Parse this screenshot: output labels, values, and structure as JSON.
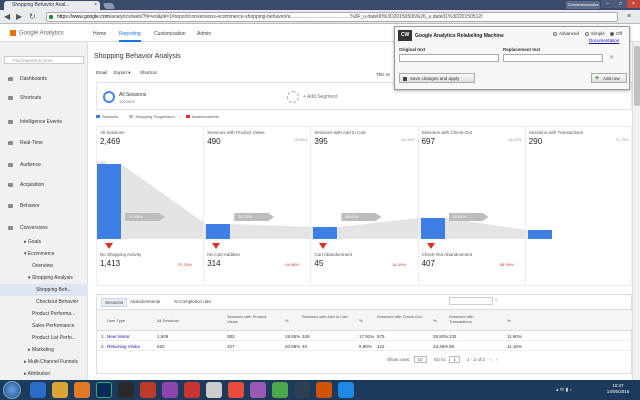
{
  "browser": {
    "tab_title": "Shopping Behavior Anal...",
    "url_host": "https://www.google.com",
    "url_path": "/analytics/web/?hl=en&pli=1#report/conversions-ecommerce-shopping-behavior/a...........................................%3F_u.date00%3D20150506%26_u.date01%3D20150512/",
    "user_button": "Conversionworks"
  },
  "ga": {
    "logo_text": "Google Analytics",
    "tabs": [
      "Home",
      "Reporting",
      "Customization",
      "Admin"
    ],
    "active_tab": "Reporting"
  },
  "sidebar": {
    "search_placeholder": "Find reports & more",
    "items": [
      {
        "label": "Dashboards"
      },
      {
        "label": "Shortcuts"
      },
      {
        "label": "Intelligence Events"
      },
      {
        "label": "Real-Time"
      },
      {
        "label": "Audience"
      },
      {
        "label": "Acquisition"
      },
      {
        "label": "Behavior"
      },
      {
        "label": "Conversions"
      },
      {
        "label": "▸ Goals"
      },
      {
        "label": "▾ Ecommerce"
      },
      {
        "label": "Overview"
      },
      {
        "label": "▾ Shopping Analysis"
      },
      {
        "label": "Shopping Beh..."
      },
      {
        "label": "Checkout Behavior"
      },
      {
        "label": "Product Performa..."
      },
      {
        "label": "Sales Performance"
      },
      {
        "label": "Product List Perfo..."
      },
      {
        "label": "▸ Marketing"
      },
      {
        "label": "▸ Multi-Channel Funnels"
      },
      {
        "label": "▸ Attribution"
      }
    ]
  },
  "report": {
    "title": "Shopping Behavior Analysis",
    "toolbar": [
      "Email",
      "Export ▾",
      "Shortcut"
    ],
    "date_fragment": "This re",
    "segment1_label": "All Sessions",
    "segment1_pct": "100.00%",
    "segment2_label": "+ Add Segment",
    "legend": [
      "Sessions",
      "Shopping Progression",
      "Abandonments"
    ]
  },
  "colors": {
    "bar": "#3e7fe6",
    "progression": "#bdbdbd",
    "abandon": "#d93025",
    "accent": "#1a73e8"
  },
  "chart_data": {
    "type": "bar",
    "stages": [
      {
        "label": "All Sessions",
        "value": "2,469",
        "pct": "",
        "bar_value": 2469
      },
      {
        "label": "Sessions with Product Views",
        "value": "490",
        "pct": "19.85%",
        "bar_value": 490
      },
      {
        "label": "Sessions with Add to Cart",
        "value": "395",
        "pct": "16.00%",
        "bar_value": 395
      },
      {
        "label": "Sessions with Check-Out",
        "value": "697",
        "pct": "28.23%",
        "bar_value": 697
      },
      {
        "label": "Sessions with Transactions",
        "value": "290",
        "pct": "11.75%",
        "bar_value": 290
      }
    ],
    "progression_rates": [
      "19.85%",
      "31.22%",
      "88.61%",
      "41.61%"
    ],
    "abandonments": [
      {
        "label": "No Shopping Activity",
        "value": "1,413",
        "pct": "57.23%"
      },
      {
        "label": "No Cart Addition",
        "value": "314",
        "pct": "64.08%"
      },
      {
        "label": "Cart Abandonment",
        "value": "45",
        "pct": "11.39%"
      },
      {
        "label": "Check-Out Abandonment",
        "value": "407",
        "pct": "58.39%"
      }
    ],
    "yticks": [
      "2,500",
      "2,000",
      "1,500",
      "1,000",
      "500",
      "0"
    ],
    "ylim": [
      0,
      2500
    ]
  },
  "table": {
    "tabs": [
      "Sessions",
      "Abandonments",
      "% Completion rate"
    ],
    "search_placeholder": "",
    "headers": [
      "User Type",
      "All Sessions",
      "Sessions with Product Views",
      "%",
      "Sessions with Add to Cart",
      "%",
      "Sessions with Check-Out",
      "%",
      "Sessions with Transactions",
      "%"
    ],
    "rows": [
      [
        "1.",
        "New Visitor",
        "1,949",
        "383",
        "19.65%",
        "349",
        "17.91%",
        "575",
        "29.50%",
        "232",
        "11.90%"
      ],
      [
        "2.",
        "Returning Visitor",
        "520",
        "107",
        "20.58%",
        "46",
        "8.85%",
        "122",
        "23.46%",
        "58",
        "11.15%"
      ]
    ],
    "show_rows_label": "Show rows:",
    "show_rows_value": "10",
    "goto_label": "Go to:",
    "goto_value": "1",
    "range_text": "1 - 2 of 2"
  },
  "popup": {
    "logo": "CW",
    "title": "Google Analytics Relabeling Machine",
    "modes": [
      "Advanced",
      "Simple",
      "Off"
    ],
    "selected_mode": "Off",
    "doc_link": "Documentation",
    "original_label": "Original text",
    "replacement_label": "Replacement text",
    "save_label": "Save changes and apply",
    "add_label": "Add row"
  },
  "taskbar": {
    "time": "10:47",
    "date": "14/05/2015"
  }
}
